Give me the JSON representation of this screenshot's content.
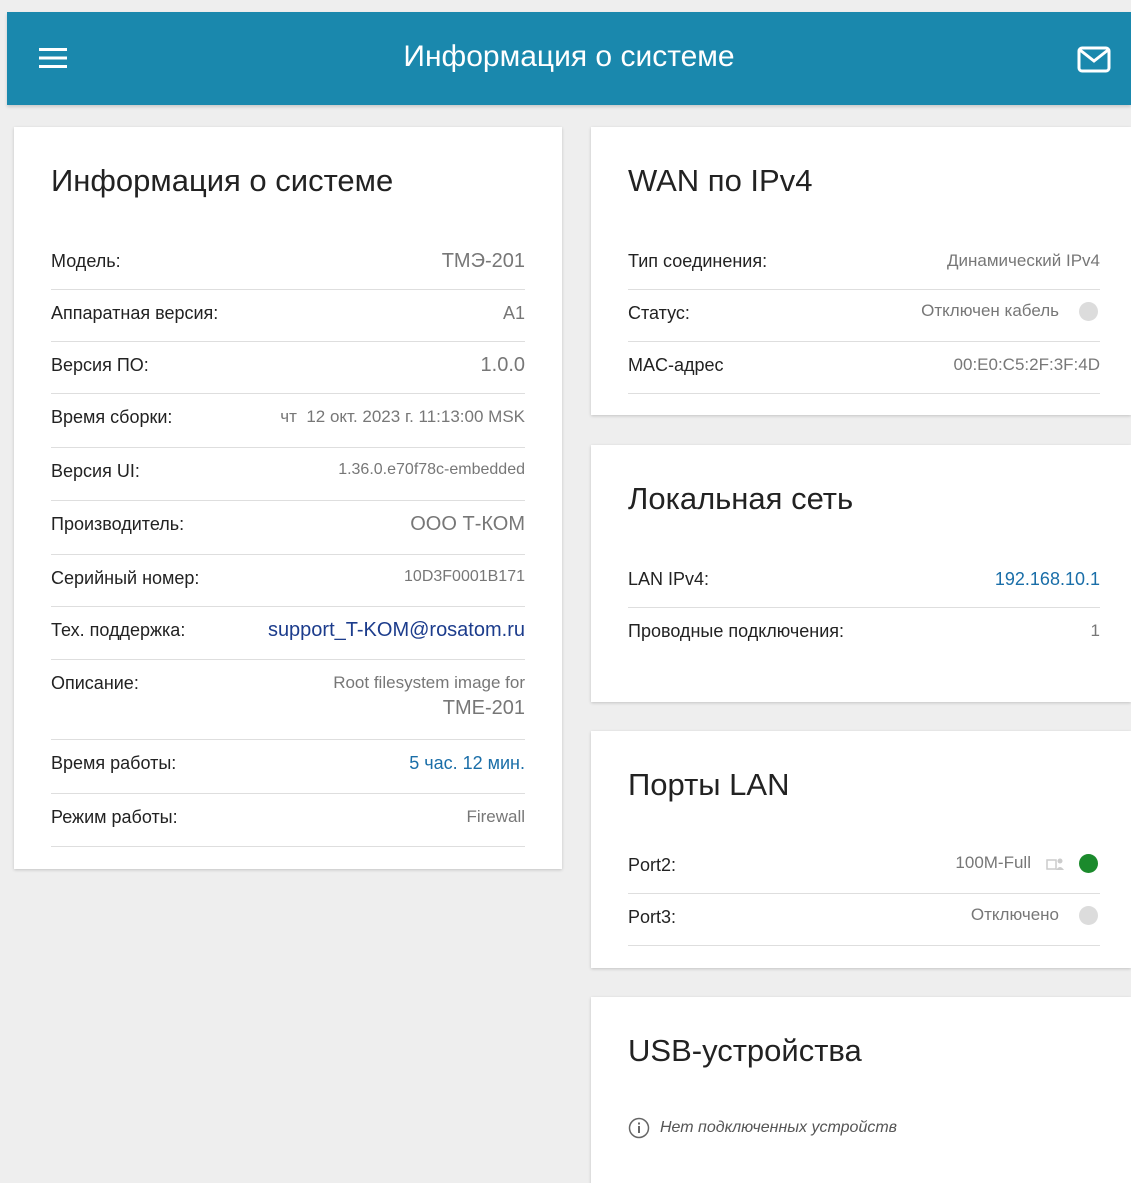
{
  "header": {
    "title": "Информация о системе"
  },
  "system": {
    "title": "Информация о системе",
    "rows": [
      {
        "label": "Модель:",
        "value": "ТМЭ-201"
      },
      {
        "label": "Аппаратная версия:",
        "value": "A1"
      },
      {
        "label": "Версия ПО:",
        "value": "1.0.0"
      },
      {
        "label": "Время сборки:",
        "value": "чт  12 окт. 2023 г. 11:13:00 MSK"
      },
      {
        "label": "Версия UI:",
        "value": "1.36.0.e70f78c-embedded"
      },
      {
        "label": "Производитель:",
        "value": "ООО Т-КОМ"
      },
      {
        "label": "Серийный номер:",
        "value": "10D3F0001B171"
      },
      {
        "label": "Тех. поддержка:",
        "value": "support_T-KOM@rosatom.ru"
      },
      {
        "label": "Описание:",
        "value_line1": "Root filesystem image for",
        "value_line2": "TME-201"
      },
      {
        "label": "Время работы:",
        "value": "5 час. 12 мин."
      },
      {
        "label": "Режим работы:",
        "value": "Firewall"
      }
    ]
  },
  "wan": {
    "title": "WAN по IPv4",
    "rows": [
      {
        "label": "Тип соединения:",
        "value": "Динамический IPv4"
      },
      {
        "label": "Статус:",
        "value": "Отключен кабель"
      },
      {
        "label": "MAC-адрес",
        "value": "00:E0:C5:2F:3F:4D"
      }
    ]
  },
  "lan": {
    "title": "Локальная сеть",
    "rows": [
      {
        "label": "LAN IPv4:",
        "value": "192.168.10.1"
      },
      {
        "label": "Проводные подключения:",
        "value": "1"
      }
    ]
  },
  "ports": {
    "title": "Порты LAN",
    "rows": [
      {
        "label": "Port2:",
        "value": "100M-Full",
        "status": "connected"
      },
      {
        "label": "Port3:",
        "value": "Отключено",
        "status": "disconnected"
      }
    ]
  },
  "usb": {
    "title": "USB-устройства",
    "empty_text": "Нет подключенных устройств"
  },
  "colors": {
    "header_bg": "#1a88ad",
    "link": "#1a6ea8",
    "status_connected": "#1b8a2c",
    "status_disconnected": "#dcdcdc"
  },
  "icons": {
    "menu": "hamburger-menu-icon",
    "mail": "envelope-icon",
    "lan_port": "lan-port-icon",
    "info": "info-circle-icon"
  }
}
